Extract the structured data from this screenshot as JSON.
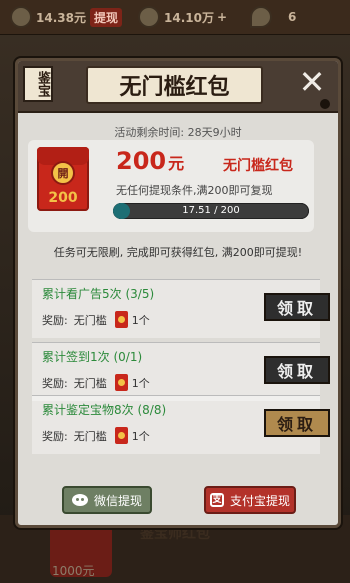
{
  "topbar": {
    "balance_value": "14.38元",
    "withdraw_label": "提现",
    "coins_value": "14.10万",
    "magnifier_value": "6"
  },
  "bottom": {
    "card_value": "1000元",
    "card_title": "鉴宝师红包"
  },
  "panel": {
    "seal_text": "鉴宝",
    "title": "无门槛红包",
    "close_symbol": "✕",
    "remaining_time": "活动剩余时间: 28天9小时"
  },
  "redpacket": {
    "envelope_seal": "開",
    "envelope_amount": "200",
    "amount": "200",
    "amount_unit": "元",
    "name": "无门槛红包",
    "condition": "无任何提现条件,满200即可复现",
    "progress_current": 17.51,
    "progress_target": 200,
    "progress_text": "17.51 / 200"
  },
  "notice": "任务可无限刷, 完成即可获得红包, 满200即可提现!",
  "tasks": [
    {
      "title": "累计看广告5次",
      "progress": "(3/5)",
      "reward_label": "奖励:",
      "reward_name": "无门槛",
      "reward_count": "1个",
      "button": "领取",
      "button_state": "dark"
    },
    {
      "title": "累计签到1次",
      "progress": "(0/1)",
      "reward_label": "奖励:",
      "reward_name": "无门槛",
      "reward_count": "1个",
      "button": "领取",
      "button_state": "dark"
    },
    {
      "title": "累计鉴定宝物8次",
      "progress": "(8/8)",
      "reward_label": "奖励:",
      "reward_name": "无门槛",
      "reward_count": "1个",
      "button": "领取",
      "button_state": "gold"
    }
  ],
  "actions": {
    "wechat_label": "微信提现",
    "alipay_label": "支付宝提现",
    "alipay_icon": "支"
  },
  "colors": {
    "accent_red": "#c8271b",
    "task_green": "#2c8a3b",
    "progress_fill": "#1d6e74"
  }
}
